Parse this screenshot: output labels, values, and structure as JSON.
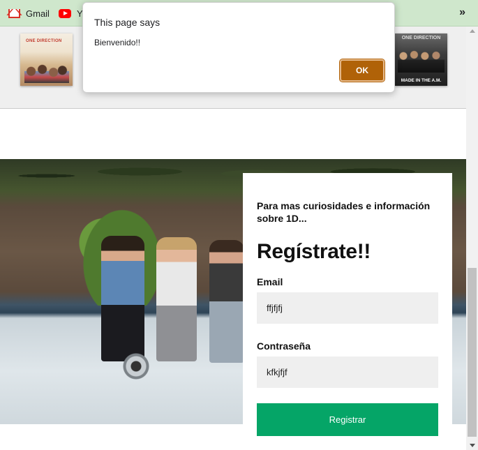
{
  "browser": {
    "bookmarks": [
      {
        "label": "Gmail",
        "icon": "gmail-icon"
      },
      {
        "label": "Yo",
        "icon": "youtube-icon"
      }
    ],
    "more_label": "»"
  },
  "albums": [
    {
      "title": "ONE DIRECTION",
      "alt": "One Direction album cover"
    },
    {
      "title": "ONE DIRECTION",
      "subtitle": "MADE IN THE A.M."
    }
  ],
  "form": {
    "kicker": "Para mas curiosidades e información sobre 1D...",
    "title": "Regístrate!!",
    "email_label": "Email",
    "email_value": "ffjfjfj",
    "password_label": "Contraseña",
    "password_value": "kfkjfjf",
    "submit_label": "Registrar",
    "submit_color": "#05a567"
  },
  "dialog": {
    "title": "This page says",
    "message": "Bienvenido!!",
    "ok_label": "OK",
    "ok_color": "#b06208"
  }
}
